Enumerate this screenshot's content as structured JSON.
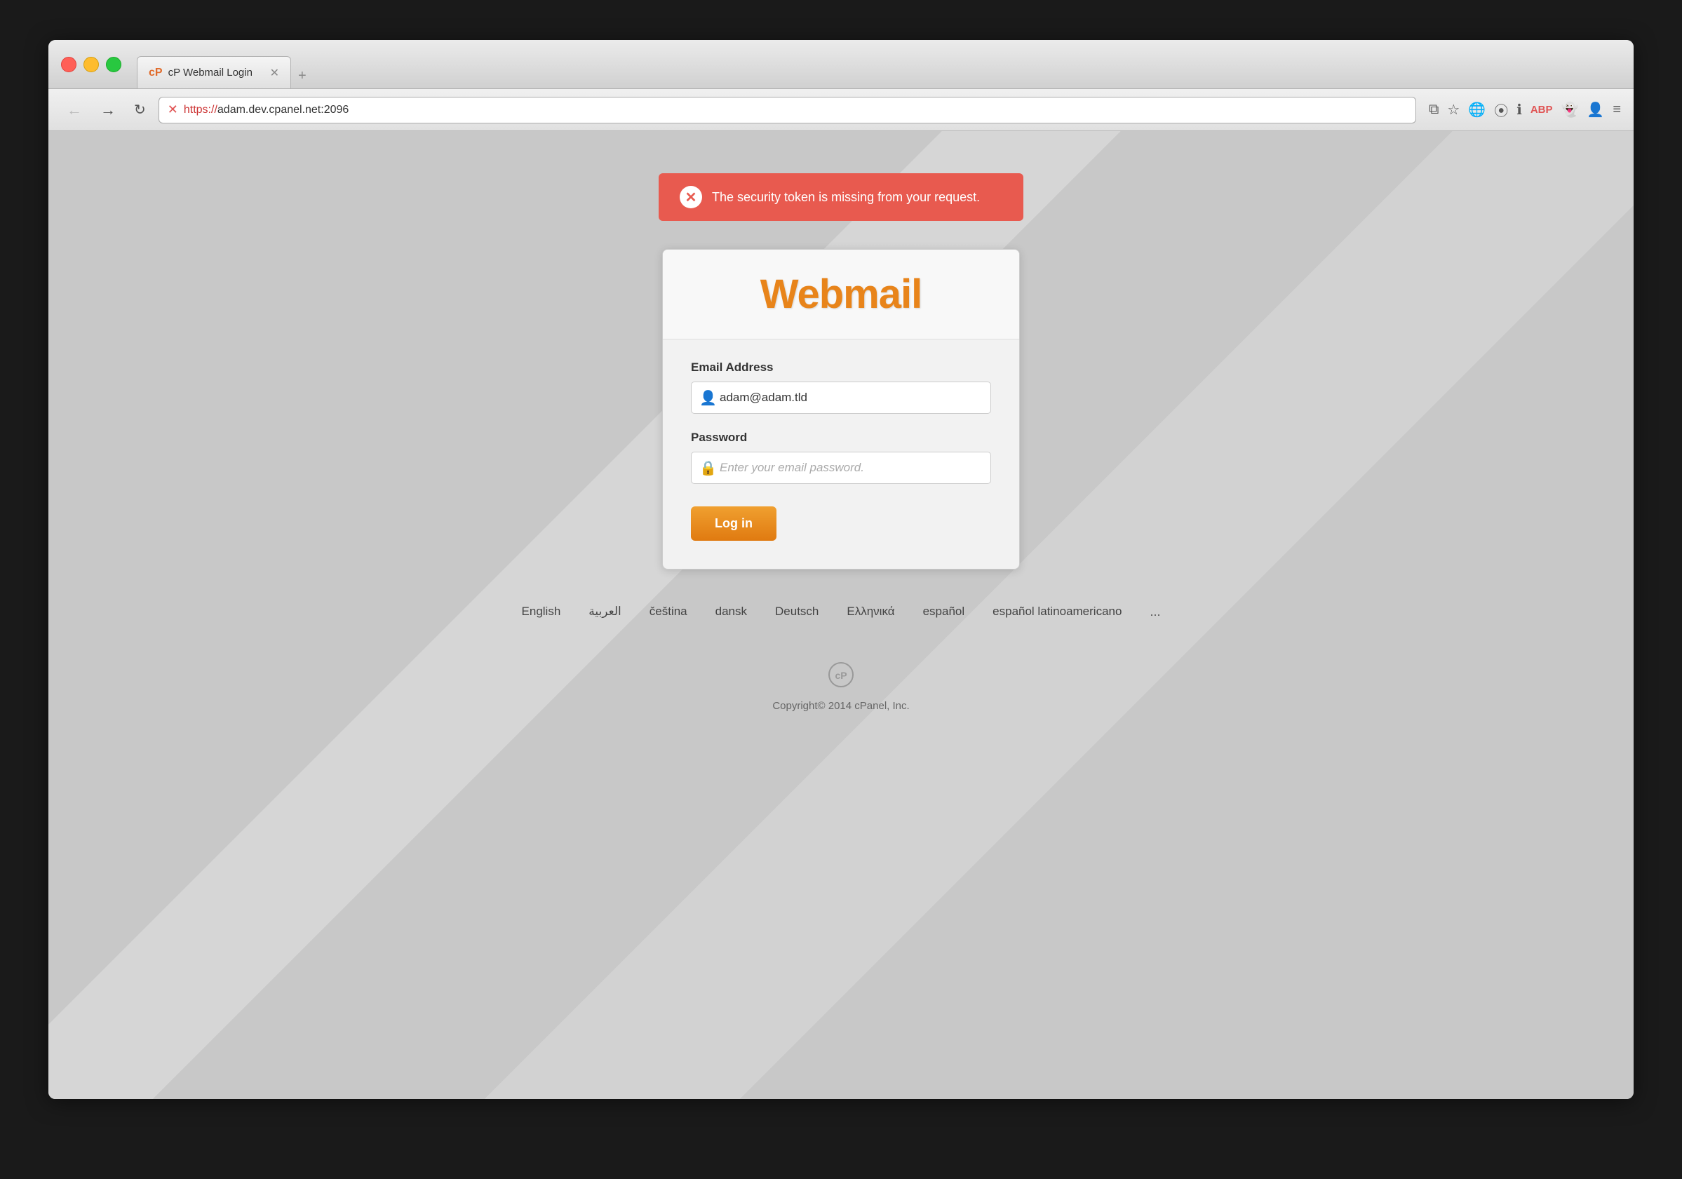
{
  "browser": {
    "tab_title": "cP Webmail Login",
    "tab_favicon": "cP",
    "url_display": "https://adam.dev.cpanel.net:2096",
    "url_https": "https://",
    "url_rest": "adam.dev.cpanel.net:2096",
    "new_tab_label": "+"
  },
  "error": {
    "message": "The security token is missing from your request."
  },
  "login": {
    "title": "Webmail",
    "email_label": "Email Address",
    "email_value": "adam@adam.tld",
    "password_label": "Password",
    "password_placeholder": "Enter your email password.",
    "login_button": "Log in"
  },
  "languages": {
    "items": [
      {
        "label": "English"
      },
      {
        "label": "العربية"
      },
      {
        "label": "čeština"
      },
      {
        "label": "dansk"
      },
      {
        "label": "Deutsch"
      },
      {
        "label": "Ελληνικά"
      },
      {
        "label": "español"
      },
      {
        "label": "español latinoamericano"
      },
      {
        "label": "..."
      }
    ]
  },
  "footer": {
    "copyright": "Copyright© 2014 cPanel, Inc."
  }
}
